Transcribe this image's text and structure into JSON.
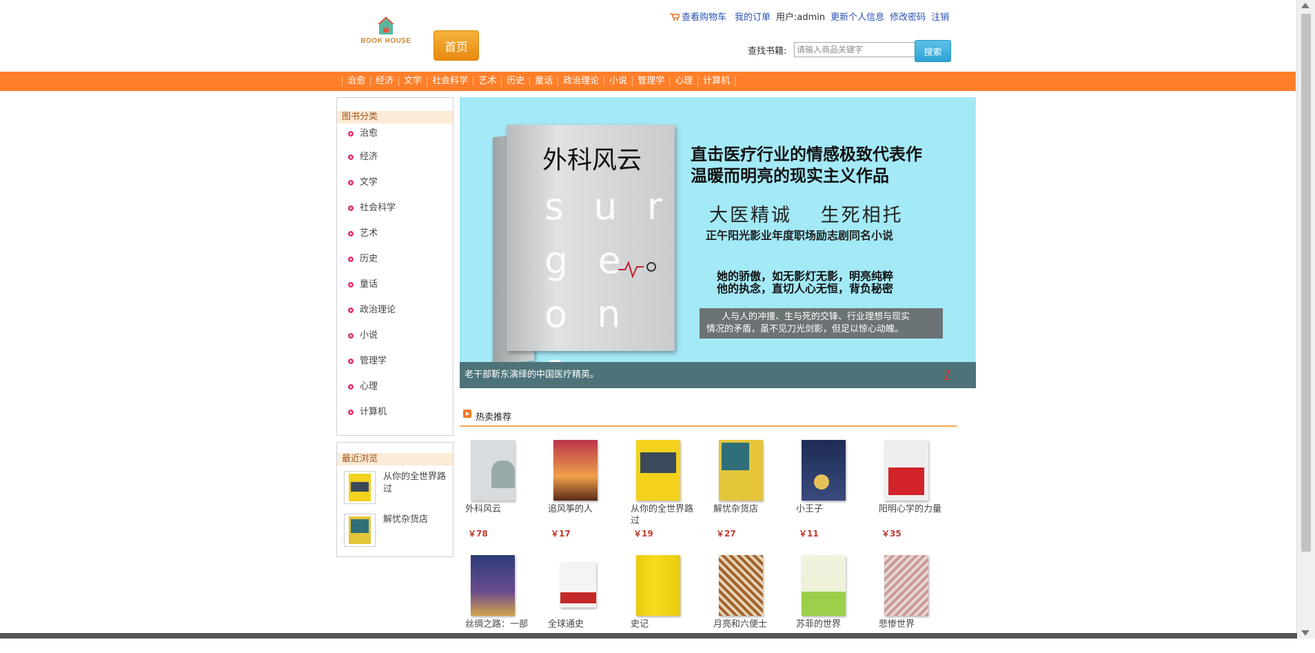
{
  "header": {
    "logo_text": "BOOK HOUSE",
    "home_label": "首页",
    "top_links": {
      "cart": "查看购物车",
      "orders": "我的订单",
      "user": "用户:admin",
      "update_info": "更新个人信息",
      "change_password": "修改密码",
      "logout": "注销"
    },
    "search": {
      "label": "查找书籍:",
      "placeholder": "请输入商品关键字",
      "button": "搜索"
    }
  },
  "nav": {
    "items": [
      "治愈",
      "经济",
      "文学",
      "社会科学",
      "艺术",
      "历史",
      "童话",
      "政治理论",
      "小说",
      "管理学",
      "心理",
      "计算机"
    ]
  },
  "sidebar": {
    "categories_title": "图书分类",
    "categories": [
      "治愈",
      "经济",
      "文学",
      "社会科学",
      "艺术",
      "历史",
      "童话",
      "政治理论",
      "小说",
      "管理学",
      "心理",
      "计算机"
    ],
    "recent_title": "最近浏览",
    "recent": [
      {
        "name": "从你的全世界路过"
      },
      {
        "name": "解忧杂货店"
      }
    ]
  },
  "banner": {
    "cover_title": "外科风云",
    "cover_letters": "s u r g e o n s",
    "headline_1": "直击医疗行业的情感极致代表作",
    "headline_2": "温暖而明亮的现实主义作品",
    "tagline": "大医精诚　 生死相托",
    "subline": "正午阳光影业年度职场励志剧同名小说",
    "quote_1": "她的骄傲，如无影灯无影，明亮纯粹",
    "quote_2": "他的执念，直切人心无恒，背负秘密",
    "box_1": "人与人的冲撞、生与死的交锋、行业理想与现实",
    "box_2": "情况的矛盾，虽不见刀光剑影，但足以惊心动魄。",
    "caption": "老干部靳东演绎的中国医疗精英。",
    "slide_number": "1"
  },
  "hot": {
    "title": "热卖推荐",
    "row1": [
      {
        "name": "外科风云",
        "price": "￥78",
        "color": "#d9dcde"
      },
      {
        "name": "追风筝的人",
        "price": "￥17",
        "color": "#d9783a"
      },
      {
        "name": "从你的全世界路过",
        "price": "￥19",
        "color": "#f2d21c"
      },
      {
        "name": "解忧杂货店",
        "price": "￥27",
        "color": "#e4c53a"
      },
      {
        "name": "小王子",
        "price": "￥11",
        "color": "#2a3a66"
      },
      {
        "name": "阳明心学的力量",
        "price": "￥35",
        "color": "#e9e9e9"
      }
    ],
    "row2": [
      {
        "name": "丝绸之路：一部",
        "price": "",
        "color": "#3a4d8a"
      },
      {
        "name": "全球通史",
        "price": "",
        "color": "#f1f1f1"
      },
      {
        "name": "史记",
        "price": "",
        "color": "#f2d70f"
      },
      {
        "name": "月亮和六便士",
        "price": "",
        "color": "#a0602e"
      },
      {
        "name": "苏菲的世界",
        "price": "",
        "color": "#eef0d8"
      },
      {
        "name": "悲惨世界",
        "price": "",
        "color": "#c99a9a"
      }
    ]
  }
}
